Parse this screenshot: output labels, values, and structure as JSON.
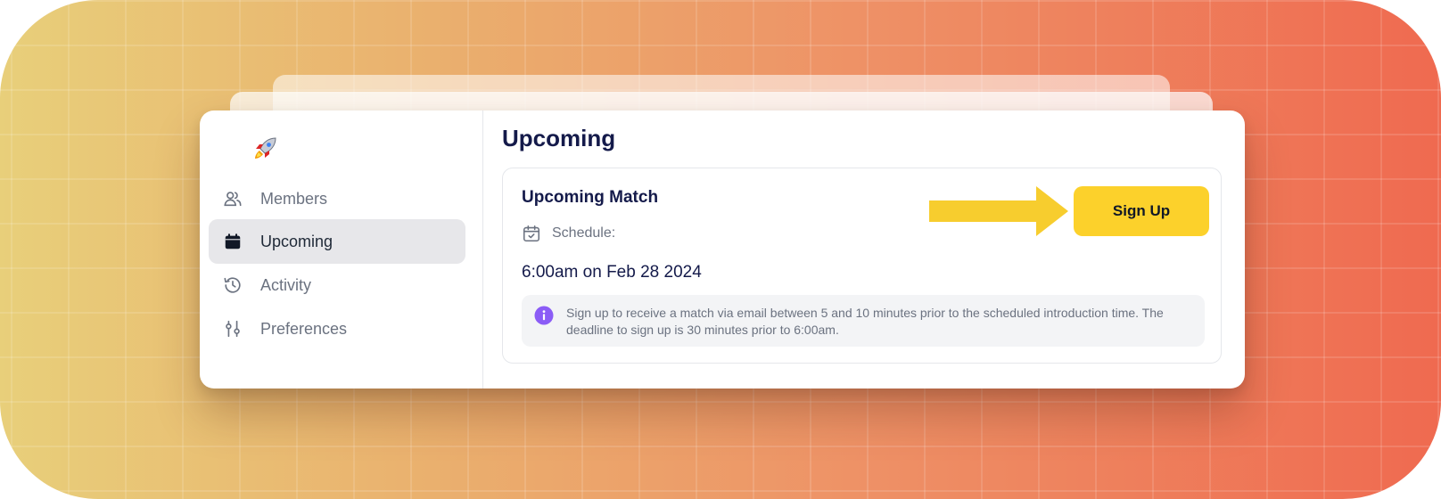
{
  "sidebar": {
    "logo": "rocket-icon",
    "items": [
      {
        "label": "Members",
        "icon": "members-icon",
        "active": false
      },
      {
        "label": "Upcoming",
        "icon": "calendar-icon",
        "active": true
      },
      {
        "label": "Activity",
        "icon": "history-icon",
        "active": false
      },
      {
        "label": "Preferences",
        "icon": "sliders-icon",
        "active": false
      }
    ]
  },
  "main": {
    "title": "Upcoming",
    "match": {
      "title": "Upcoming Match",
      "schedule_label": "Schedule:",
      "datetime": "6:00am on Feb 28 2024",
      "info": "Sign up to receive a match via email between 5 and 10 minutes prior to the scheduled introduction time. The deadline to sign up is 30 minutes prior to 6:00am.",
      "signup_label": "Sign Up"
    }
  },
  "colors": {
    "accent": "#fcd12b",
    "title": "#141a4a",
    "info_icon": "#8b5cf6",
    "background_start": "#e8cf7a",
    "background_end": "#ef6a50"
  }
}
